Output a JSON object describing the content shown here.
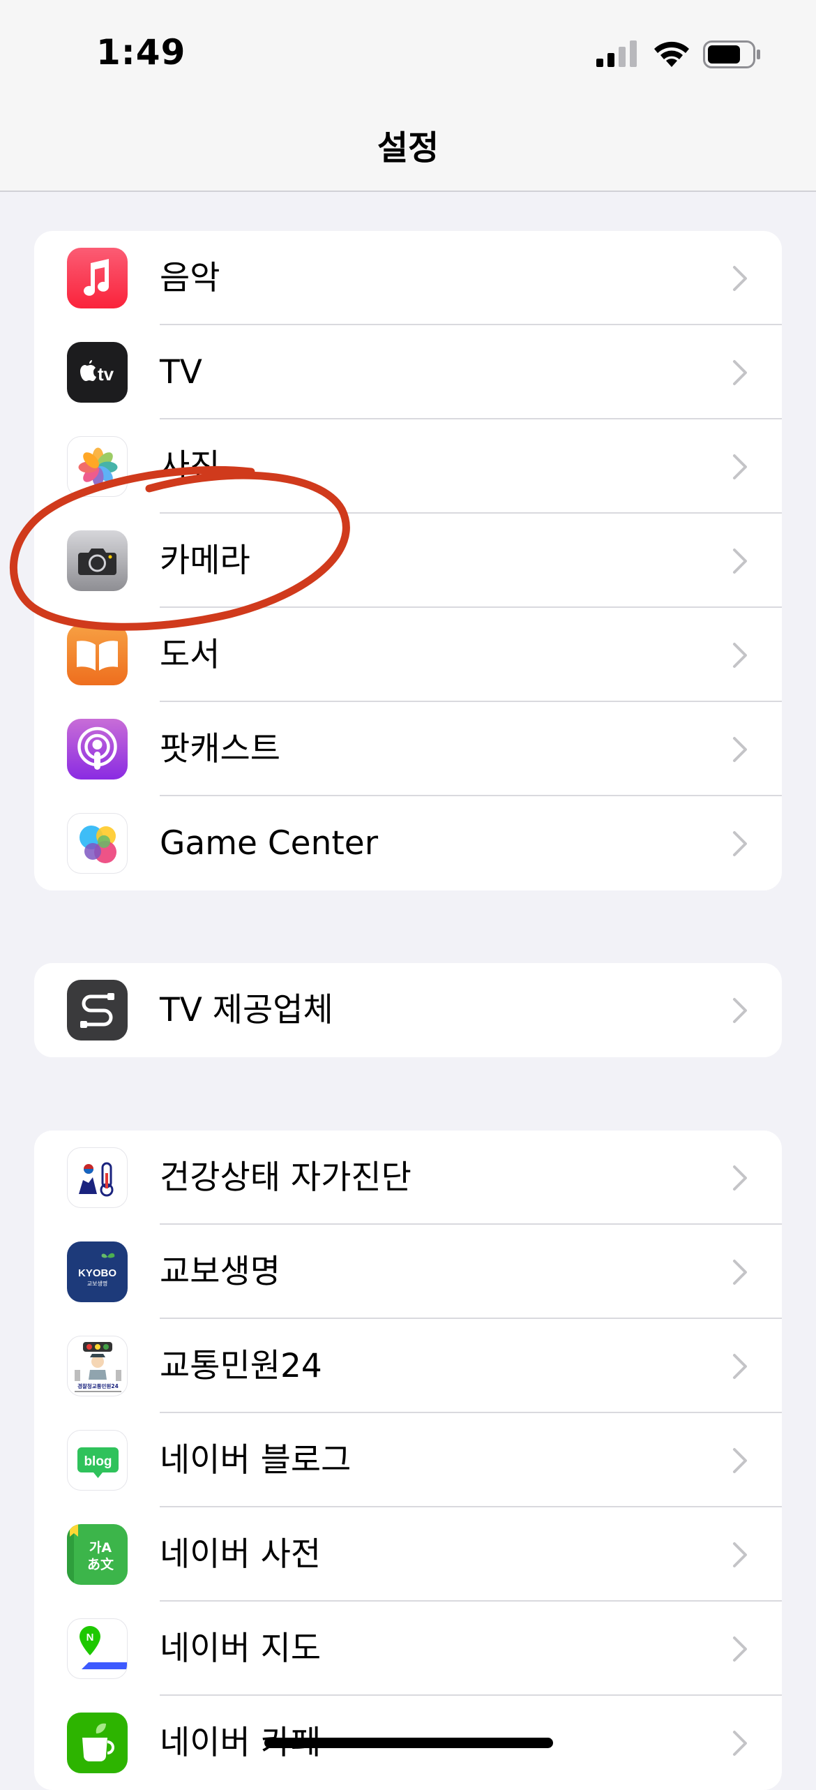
{
  "status_bar": {
    "time": "1:49"
  },
  "nav": {
    "title": "설정"
  },
  "groups": [
    {
      "items": [
        {
          "label": "음악",
          "icon": "music-icon",
          "color": "#fa3f55"
        },
        {
          "label": "TV",
          "icon": "apple-tv-icon",
          "color": "#1c1c1e",
          "icon_text": "tv"
        },
        {
          "label": "사진",
          "icon": "photos-icon"
        },
        {
          "label": "카메라",
          "icon": "camera-icon",
          "color": "#8e8e93"
        },
        {
          "label": "도서",
          "icon": "books-icon",
          "color": "#f28b30"
        },
        {
          "label": "팟캐스트",
          "icon": "podcasts-icon",
          "color": "#9d4edd"
        },
        {
          "label": "Game Center",
          "icon": "game-center-icon"
        }
      ]
    },
    {
      "items": [
        {
          "label": "TV 제공업체",
          "icon": "tv-provider-icon",
          "color": "#3a3a3c"
        }
      ]
    },
    {
      "items": [
        {
          "label": "건강상태 자가진단",
          "icon": "health-selfcheck-icon"
        },
        {
          "label": "교보생명",
          "icon": "kyobo-icon",
          "color": "#1d3a7a",
          "icon_text": "KYOBO",
          "icon_subtext": "교보생명"
        },
        {
          "label": "교통민원24",
          "icon": "traffic-complaint-icon",
          "icon_text": "경찰청교통민원24"
        },
        {
          "label": "네이버 블로그",
          "icon": "naver-blog-icon",
          "color": "#2fc25b",
          "icon_text": "blog"
        },
        {
          "label": "네이버 사전",
          "icon": "naver-dictionary-icon",
          "color": "#3cb54a",
          "icon_text": "가A",
          "icon_subtext": "あ文"
        },
        {
          "label": "네이버 지도",
          "icon": "naver-map-icon",
          "icon_text": "N"
        },
        {
          "label": "네이버 카페",
          "icon": "naver-cafe-icon",
          "color": "#2db400"
        }
      ]
    }
  ],
  "annotation": {
    "shape": "ellipse",
    "color": "#d03a1c",
    "target": "카메라"
  }
}
